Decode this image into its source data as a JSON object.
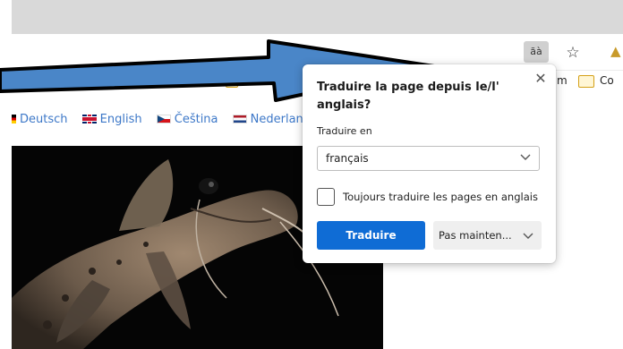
{
  "toolbar": {
    "translate_icon_text": "ãà",
    "favorite_icon": "star-plus-icon",
    "extension_icon": "extension-icon"
  },
  "favorites_bar": {
    "partial_label_before": "m",
    "folder_label": "Co"
  },
  "page": {
    "languages": [
      {
        "label": "Deutsch",
        "flag": "de"
      },
      {
        "label": "English",
        "flag": "gb"
      },
      {
        "label": "Čeština",
        "flag": "cz"
      },
      {
        "label": "Nederlands",
        "flag": "nl"
      }
    ]
  },
  "popup": {
    "title": "Traduire la page depuis le/l' anglais?",
    "translate_to_label": "Traduire en",
    "selected_language": "français",
    "always_translate_label": "Toujours traduire les pages en anglais",
    "always_translate_checked": false,
    "translate_button_label": "Traduire",
    "not_now_label": "Pas mainten..."
  },
  "colors": {
    "accent": "#0f6cd5",
    "link": "#3d78c8",
    "arrow_fill": "#4a86c8"
  }
}
